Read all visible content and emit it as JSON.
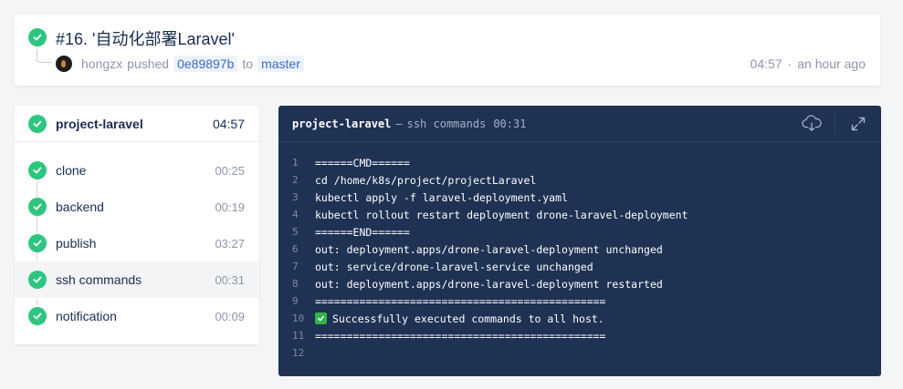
{
  "build": {
    "title": "#16. '自动化部署Laravel'",
    "author": "hongzx",
    "action": "pushed",
    "commit": "0e89897b",
    "to_label": "to",
    "branch": "master",
    "duration": "04:57",
    "time_ago": "an hour ago",
    "status_color": "#2ec67f"
  },
  "stage": {
    "name": "project-laravel",
    "time": "04:57"
  },
  "steps": [
    {
      "name": "clone",
      "time": "00:25"
    },
    {
      "name": "backend",
      "time": "00:19"
    },
    {
      "name": "publish",
      "time": "03:27"
    },
    {
      "name": "ssh commands",
      "time": "00:31"
    },
    {
      "name": "notification",
      "time": "00:09"
    }
  ],
  "log": {
    "stage": "project-laravel",
    "separator": "—",
    "step": "ssh commands",
    "duration": "00:31",
    "download_icon": "download-cloud-icon",
    "expand_icon": "expand-icon",
    "lines": [
      {
        "n": "1",
        "text": "======CMD======"
      },
      {
        "n": "2",
        "text": "cd /home/k8s/project/projectLaravel"
      },
      {
        "n": "3",
        "text": "kubectl apply -f laravel-deployment.yaml"
      },
      {
        "n": "4",
        "text": "kubectl rollout restart deployment drone-laravel-deployment"
      },
      {
        "n": "5",
        "text": "======END======"
      },
      {
        "n": "6",
        "text": "out: deployment.apps/drone-laravel-deployment unchanged"
      },
      {
        "n": "7",
        "text": "out: service/drone-laravel-service unchanged"
      },
      {
        "n": "8",
        "text": "out: deployment.apps/drone-laravel-deployment restarted"
      },
      {
        "n": "9",
        "text": "=============================================="
      },
      {
        "n": "10",
        "text": "Successfully executed commands to all host."
      },
      {
        "n": "11",
        "text": "=============================================="
      },
      {
        "n": "12",
        "text": ""
      }
    ]
  }
}
